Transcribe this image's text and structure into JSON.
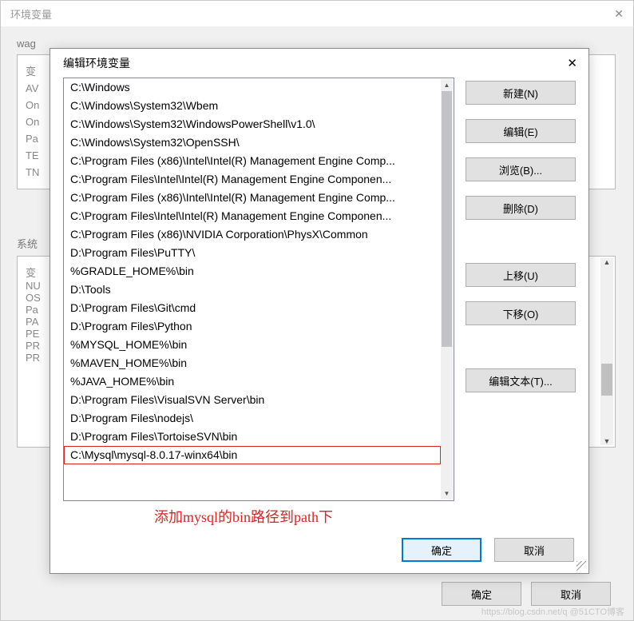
{
  "parent": {
    "title": "环境变量",
    "user_label": "wag",
    "section2_label": "系统",
    "behind_col": "变",
    "behind_rows": [
      "AV",
      "On",
      "On",
      "Pa",
      "TE",
      "TN"
    ],
    "behind_col2": "变",
    "behind_rows2": [
      "NU",
      "OS",
      "Pa",
      "PA",
      "PE",
      "PR",
      "PR"
    ],
    "ok": "确定",
    "cancel": "取消"
  },
  "modal": {
    "title": "编辑环境变量",
    "paths": [
      "C:\\Windows",
      "C:\\Windows\\System32\\Wbem",
      "C:\\Windows\\System32\\WindowsPowerShell\\v1.0\\",
      "C:\\Windows\\System32\\OpenSSH\\",
      "C:\\Program Files (x86)\\Intel\\Intel(R) Management Engine Comp...",
      "C:\\Program Files\\Intel\\Intel(R) Management Engine Componen...",
      "C:\\Program Files (x86)\\Intel\\Intel(R) Management Engine Comp...",
      "C:\\Program Files\\Intel\\Intel(R) Management Engine Componen...",
      "C:\\Program Files (x86)\\NVIDIA Corporation\\PhysX\\Common",
      "D:\\Program Files\\PuTTY\\",
      "%GRADLE_HOME%\\bin",
      "D:\\Tools",
      "D:\\Program Files\\Git\\cmd",
      "D:\\Program Files\\Python",
      "%MYSQL_HOME%\\bin",
      "%MAVEN_HOME%\\bin",
      "%JAVA_HOME%\\bin",
      "D:\\Program Files\\VisualSVN Server\\bin",
      "D:\\Program Files\\nodejs\\",
      "D:\\Program Files\\TortoiseSVN\\bin",
      "C:\\Mysql\\mysql-8.0.17-winx64\\bin"
    ],
    "highlighted_index": 20,
    "buttons": {
      "new": "新建(N)",
      "edit": "编辑(E)",
      "browse": "浏览(B)...",
      "delete": "删除(D)",
      "moveup": "上移(U)",
      "movedown": "下移(O)",
      "edit_text": "编辑文本(T)...",
      "ok": "确定",
      "cancel": "取消"
    },
    "annotation": "添加mysql的bin路径到path下"
  },
  "watermark": "https://blog.csdn.net/q @51CTO博客"
}
